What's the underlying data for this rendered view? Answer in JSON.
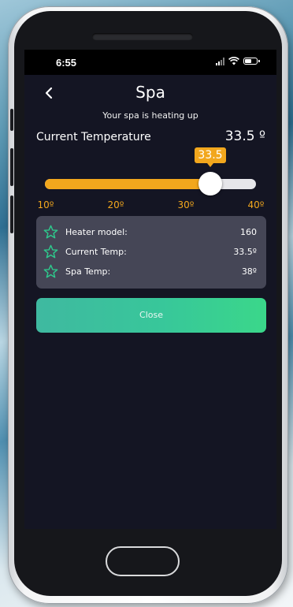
{
  "status_bar": {
    "time": "6:55"
  },
  "header": {
    "back_icon": "chevron-left-icon",
    "title": "Spa",
    "subtitle": "Your spa is heating up"
  },
  "temperature": {
    "label": "Current Temperature",
    "value": "33.5 º"
  },
  "slider": {
    "value": 33.5,
    "value_label": "33.5",
    "min": 10,
    "max": 40,
    "ticks": [
      "10º",
      "20º",
      "30º",
      "40º"
    ],
    "accent_color": "#f2a71d"
  },
  "details": {
    "icon": "star-outline-icon",
    "icon_color": "#2ec98c",
    "rows": [
      {
        "label": "Heater model:",
        "value": "160"
      },
      {
        "label": "Current Temp:",
        "value": "33.5º"
      },
      {
        "label": "Spa Temp:",
        "value": "38º"
      }
    ]
  },
  "actions": {
    "close_label": "Close"
  }
}
